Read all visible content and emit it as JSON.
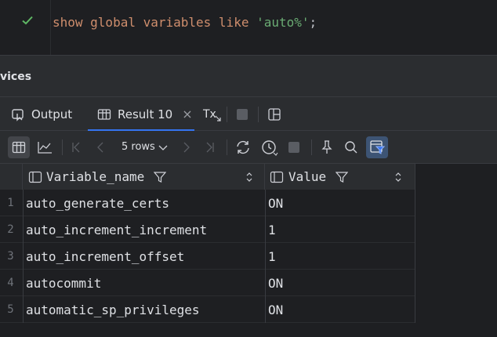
{
  "editor": {
    "status": "check-icon",
    "code": {
      "kw1": "show global variables like",
      "str": "'auto%'",
      "semi": ";"
    }
  },
  "panel": {
    "title": "vices"
  },
  "tabs": [
    {
      "label": "Output",
      "icon": "output-icon"
    },
    {
      "label": "Result 10",
      "icon": "table-icon",
      "active": true,
      "close": "×"
    },
    {
      "label": "Tx",
      "icon": "tx-mode-icon"
    }
  ],
  "toolbar": {
    "rows_label": "5 rows",
    "accent": "#3574f0"
  },
  "table": {
    "columns": [
      "Variable_name",
      "Value"
    ],
    "rows": [
      {
        "num": "1",
        "name": "auto_generate_certs",
        "value": "ON"
      },
      {
        "num": "2",
        "name": "auto_increment_increment",
        "value": "1"
      },
      {
        "num": "3",
        "name": "auto_increment_offset",
        "value": "1"
      },
      {
        "num": "4",
        "name": "autocommit",
        "value": "ON"
      },
      {
        "num": "5",
        "name": "automatic_sp_privileges",
        "value": "ON"
      }
    ]
  }
}
